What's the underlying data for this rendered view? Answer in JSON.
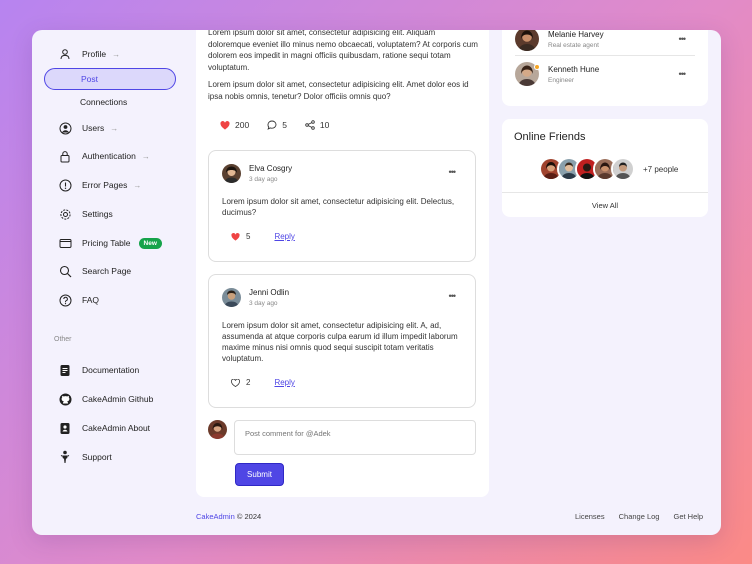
{
  "sidebar": {
    "items": [
      {
        "label": "Profile",
        "icon": "user-icon",
        "arrow": "→"
      },
      {
        "label": "Users",
        "icon": "user-circle-icon",
        "arrow": "→"
      },
      {
        "label": "Authentication",
        "icon": "lock-icon",
        "arrow": "→"
      },
      {
        "label": "Error Pages",
        "icon": "alert-icon",
        "arrow": "→"
      },
      {
        "label": "Settings",
        "icon": "gear-icon"
      },
      {
        "label": "Pricing Table",
        "icon": "wallet-icon",
        "badge": "New"
      },
      {
        "label": "Search Page",
        "icon": "search-icon"
      },
      {
        "label": "FAQ",
        "icon": "help-icon"
      }
    ],
    "sub_items": [
      "Post",
      "Connections"
    ],
    "other_label": "Other",
    "other_items": [
      {
        "label": "Documentation",
        "icon": "document-icon"
      },
      {
        "label": "CakeAdmin Github",
        "icon": "github-icon"
      },
      {
        "label": "CakeAdmin About",
        "icon": "about-icon"
      },
      {
        "label": "Support",
        "icon": "support-icon"
      }
    ]
  },
  "post": {
    "para1": "Lorem ipsum dolor sit amet, consectetur adipisicing elit. Aliquam doloremque eveniet illo minus nemo obcaecati, voluptatem? At corporis cum dolorem eos impedit in magni officiis quibusdam, ratione sequi totam voluptatum.",
    "para2": "Lorem ipsum dolor sit amet, consectetur adipisicing elit. Amet dolor eos id ipsa nobis omnis, tenetur? Dolor officiis omnis quo?",
    "likes": "200",
    "comments": "5",
    "shares": "10"
  },
  "comments": [
    {
      "name": "Elva Cosgry",
      "time": "3 day ago",
      "text": "Lorem ipsum dolor sit amet, consectetur adipisicing elit. Delectus, ducimus?",
      "likes": "5",
      "reply": "Reply"
    },
    {
      "name": "Jenni Odlin",
      "time": "3 day ago",
      "text": "Lorem ipsum dolor sit amet, consectetur adipisicing elit. A, ad, assumenda at atque corporis culpa earum id illum impedit laborum maxime minus nisi omnis quod sequi suscipit totam veritatis voluptatum.",
      "likes": "2",
      "reply": "Reply"
    }
  ],
  "compose": {
    "placeholder": "Post comment for @Adek",
    "submit": "Submit"
  },
  "friends": [
    {
      "name": "Melanie Harvey",
      "role": "Real estate agent"
    },
    {
      "name": "Kenneth Hune",
      "role": "Engineer"
    }
  ],
  "online": {
    "title": "Online Friends",
    "more": "+7 people",
    "view_all": "View All"
  },
  "footer": {
    "brand": "CakeAdmin",
    "copyright": "© 2024",
    "links": [
      "Licenses",
      "Change Log",
      "Get Help"
    ]
  },
  "colors": {
    "accent": "#4f46e5",
    "badge": "#16a34a",
    "heart": "#ef4444",
    "online": "#f5a524"
  }
}
